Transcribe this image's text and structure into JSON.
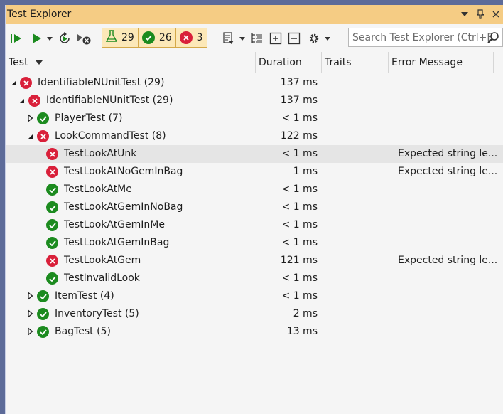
{
  "window": {
    "title": "Test Explorer"
  },
  "titlebar_icons": [
    "dropdown-icon",
    "pin-icon",
    "close-icon"
  ],
  "toolbar": {
    "run_all_icon": "run-all-icon",
    "run_icon": "run-icon",
    "repeat_run_icon": "repeat-last-run-icon",
    "cancel_icon": "cancel-run-icon",
    "total_count": "29",
    "passed_count": "26",
    "failed_count": "3",
    "search_placeholder": "Search Test Explorer (Ctrl+E"
  },
  "columns": {
    "test": "Test",
    "duration": "Duration",
    "traits": "Traits",
    "error": "Error Message"
  },
  "colors": {
    "failed": "#d9203a",
    "passed": "#1c8b1f",
    "titlebar": "#f5cc84",
    "selected_row": "#e5e5e5"
  },
  "rows": [
    {
      "label": "IdentifiableNUnitTest",
      "count": "(29)",
      "duration": "137 ms",
      "status": "failed",
      "expander": "expanded",
      "error": ""
    },
    {
      "label": "IdentifiableNUnitTest",
      "count": "(29)",
      "duration": "137 ms",
      "status": "failed",
      "expander": "expanded",
      "error": ""
    },
    {
      "label": "PlayerTest",
      "count": "(7)",
      "duration": "< 1 ms",
      "status": "passed",
      "expander": "collapsed",
      "error": ""
    },
    {
      "label": "LookCommandTest",
      "count": "(8)",
      "duration": "122 ms",
      "status": "failed",
      "expander": "expanded",
      "error": ""
    },
    {
      "label": "TestLookAtUnk",
      "count": "",
      "duration": "< 1 ms",
      "status": "failed",
      "expander": "none",
      "error": "Expected string le...",
      "selected": true
    },
    {
      "label": "TestLookAtNoGemInBag",
      "count": "",
      "duration": "1 ms",
      "status": "failed",
      "expander": "none",
      "error": "Expected string le..."
    },
    {
      "label": "TestLookAtMe",
      "count": "",
      "duration": "< 1 ms",
      "status": "passed",
      "expander": "none",
      "error": ""
    },
    {
      "label": "TestLookAtGemInNoBag",
      "count": "",
      "duration": "< 1 ms",
      "status": "passed",
      "expander": "none",
      "error": ""
    },
    {
      "label": "TestLookAtGemInMe",
      "count": "",
      "duration": "< 1 ms",
      "status": "passed",
      "expander": "none",
      "error": ""
    },
    {
      "label": "TestLookAtGemInBag",
      "count": "",
      "duration": "< 1 ms",
      "status": "passed",
      "expander": "none",
      "error": ""
    },
    {
      "label": "TestLookAtGem",
      "count": "",
      "duration": "121 ms",
      "status": "failed",
      "expander": "none",
      "error": "Expected string le..."
    },
    {
      "label": "TestInvalidLook",
      "count": "",
      "duration": "< 1 ms",
      "status": "passed",
      "expander": "none",
      "error": ""
    },
    {
      "label": "ItemTest",
      "count": "(4)",
      "duration": "< 1 ms",
      "status": "passed",
      "expander": "collapsed",
      "error": ""
    },
    {
      "label": "InventoryTest",
      "count": "(5)",
      "duration": "2 ms",
      "status": "passed",
      "expander": "collapsed",
      "error": ""
    },
    {
      "label": "BagTest",
      "count": "(5)",
      "duration": "13 ms",
      "status": "passed",
      "expander": "collapsed",
      "error": ""
    }
  ]
}
